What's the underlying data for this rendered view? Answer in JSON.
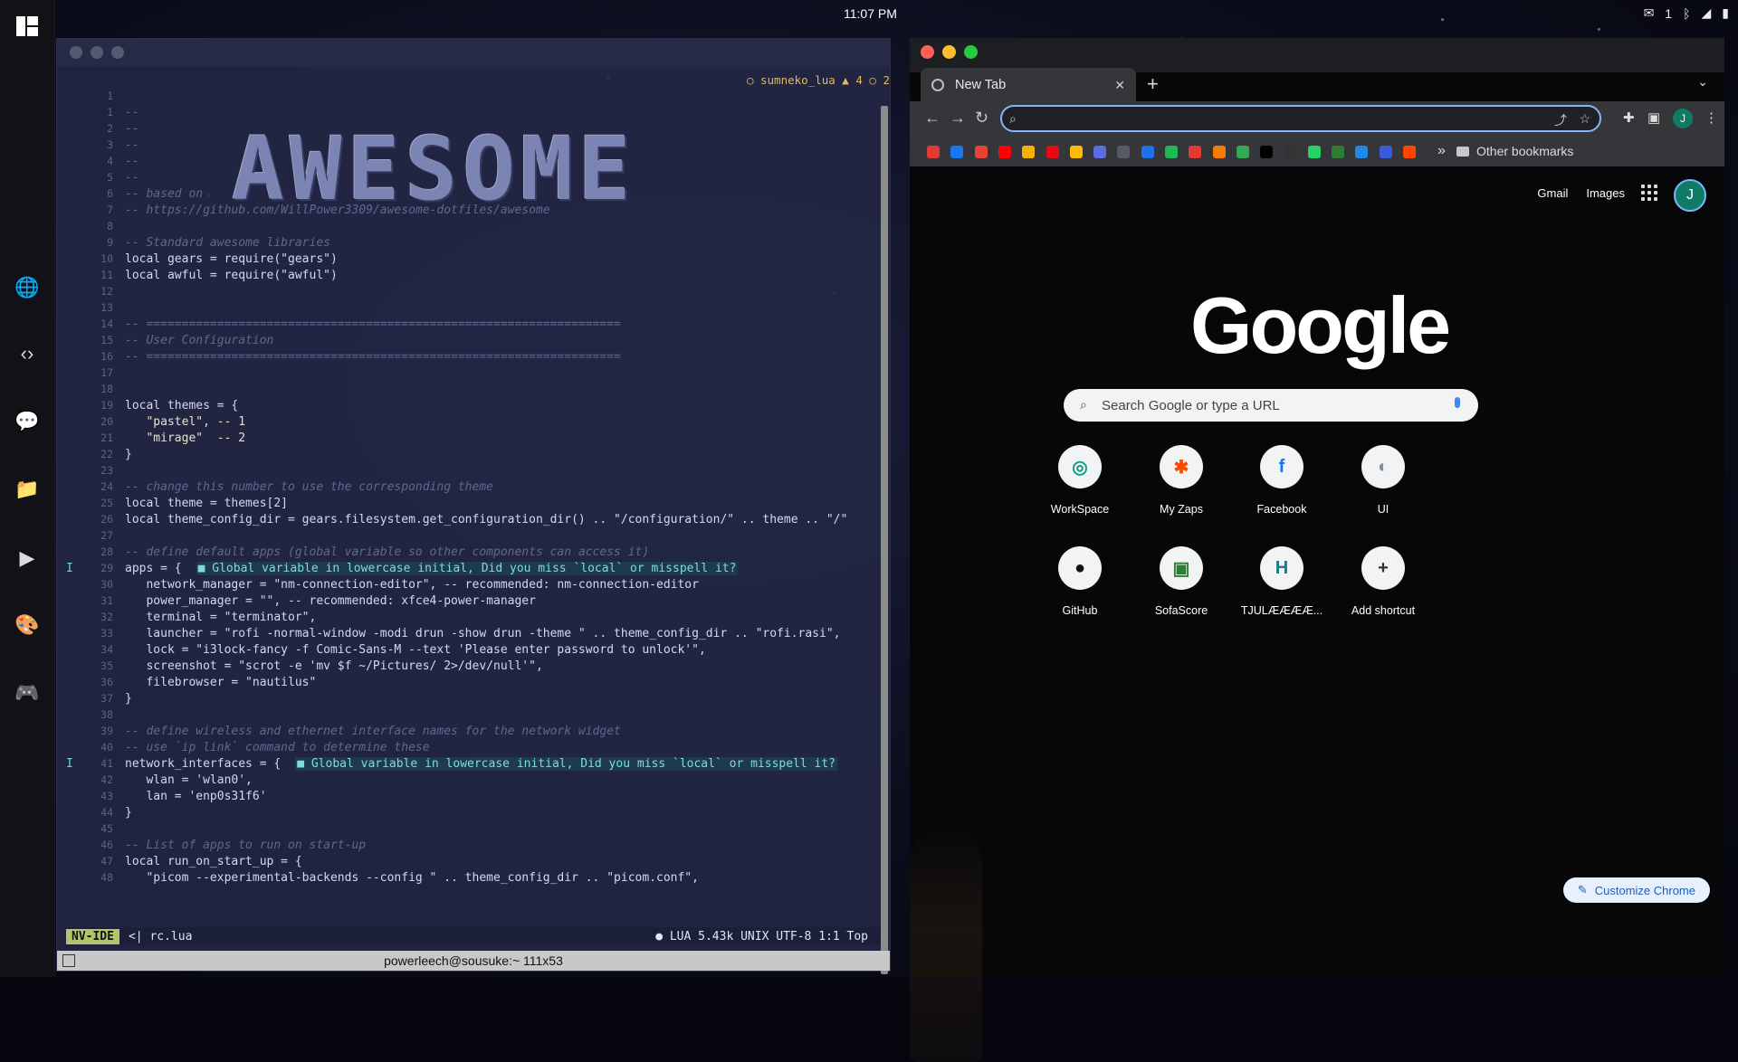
{
  "system": {
    "clock": "11:07 PM",
    "tray": {
      "mail_count": "1"
    }
  },
  "dock": {
    "items": [
      {
        "name": "globe-icon",
        "glyph": "🌐"
      },
      {
        "name": "code-icon",
        "glyph": "‹›"
      },
      {
        "name": "chat-icon",
        "glyph": "💬"
      },
      {
        "name": "folder-icon",
        "glyph": "📁"
      },
      {
        "name": "play-icon",
        "glyph": "▶"
      },
      {
        "name": "palette-icon",
        "glyph": "🎨"
      },
      {
        "name": "gamepad-icon",
        "glyph": "🎮"
      }
    ]
  },
  "terminal": {
    "lsp_status": "○ sumneko_lua  ▲ 4 ○ 2",
    "banner": "AWESOME",
    "lines": [
      {
        "n": "1",
        "t": "",
        "cls": "c-plain"
      },
      {
        "n": "1",
        "t": "--",
        "cls": "c-com"
      },
      {
        "n": "2",
        "t": "--",
        "cls": "c-com"
      },
      {
        "n": "3",
        "t": "--",
        "cls": "c-com"
      },
      {
        "n": "4",
        "t": "--",
        "cls": "c-com"
      },
      {
        "n": "5",
        "t": "--",
        "cls": "c-com"
      },
      {
        "n": "6",
        "t": "-- based on",
        "cls": "c-com"
      },
      {
        "n": "7",
        "t": "-- https://github.com/WillPower3309/awesome-dotfiles/awesome",
        "cls": "c-com"
      },
      {
        "n": "8",
        "t": "",
        "cls": "c-plain"
      },
      {
        "n": "9",
        "t": "-- Standard awesome libraries",
        "cls": "c-com"
      },
      {
        "n": "10",
        "t": "local gears = require(\"gears\")",
        "cls": "c-plain"
      },
      {
        "n": "11",
        "t": "local awful = require(\"awful\")",
        "cls": "c-plain"
      },
      {
        "n": "12",
        "t": "",
        "cls": "c-plain"
      },
      {
        "n": "13",
        "t": "",
        "cls": "c-plain"
      },
      {
        "n": "14",
        "t": "-- ===================================================================",
        "cls": "c-com"
      },
      {
        "n": "15",
        "t": "-- User Configuration",
        "cls": "c-com"
      },
      {
        "n": "16",
        "t": "-- ===================================================================",
        "cls": "c-com"
      },
      {
        "n": "17",
        "t": "",
        "cls": "c-plain"
      },
      {
        "n": "18",
        "t": "",
        "cls": "c-plain"
      },
      {
        "n": "19",
        "t": "local themes = {",
        "cls": "c-plain"
      },
      {
        "n": "20",
        "t": "   \"pastel\", -- 1",
        "cls": "c-str"
      },
      {
        "n": "21",
        "t": "   \"mirage\"  -- 2",
        "cls": "c-str"
      },
      {
        "n": "22",
        "t": "}",
        "cls": "c-plain"
      },
      {
        "n": "23",
        "t": "",
        "cls": "c-plain"
      },
      {
        "n": "24",
        "t": "-- change this number to use the corresponding theme",
        "cls": "c-com"
      },
      {
        "n": "25",
        "t": "local theme = themes[2]",
        "cls": "c-plain"
      },
      {
        "n": "26",
        "t": "local theme_config_dir = gears.filesystem.get_configuration_dir() .. \"/configuration/\" .. theme .. \"/\"",
        "cls": "c-plain"
      },
      {
        "n": "27",
        "t": "",
        "cls": "c-plain"
      },
      {
        "n": "28",
        "t": "-- define default apps (global variable so other components can access it)",
        "cls": "c-com"
      },
      {
        "n": "29",
        "t": "apps = {",
        "cls": "c-plain",
        "sign": "I",
        "diag": "■ Global variable in lowercase initial, Did you miss `local` or misspell it?"
      },
      {
        "n": "30",
        "t": "   network_manager = \"nm-connection-editor\", -- recommended: nm-connection-editor",
        "cls": "c-plain"
      },
      {
        "n": "31",
        "t": "   power_manager = \"\", -- recommended: xfce4-power-manager",
        "cls": "c-plain"
      },
      {
        "n": "32",
        "t": "   terminal = \"terminator\",",
        "cls": "c-plain"
      },
      {
        "n": "33",
        "t": "   launcher = \"rofi -normal-window -modi drun -show drun -theme \" .. theme_config_dir .. \"rofi.rasi\",",
        "cls": "c-plain"
      },
      {
        "n": "34",
        "t": "   lock = \"i3lock-fancy -f Comic-Sans-M --text 'Please enter password to unlock'\",",
        "cls": "c-plain"
      },
      {
        "n": "35",
        "t": "   screenshot = \"scrot -e 'mv $f ~/Pictures/ 2>/dev/null'\",",
        "cls": "c-plain"
      },
      {
        "n": "36",
        "t": "   filebrowser = \"nautilus\"",
        "cls": "c-plain"
      },
      {
        "n": "37",
        "t": "}",
        "cls": "c-plain"
      },
      {
        "n": "38",
        "t": "",
        "cls": "c-plain"
      },
      {
        "n": "39",
        "t": "-- define wireless and ethernet interface names for the network widget",
        "cls": "c-com"
      },
      {
        "n": "40",
        "t": "-- use `ip link` command to determine these",
        "cls": "c-com"
      },
      {
        "n": "41",
        "t": "network_interfaces = {",
        "cls": "c-plain",
        "sign": "I",
        "diag": "■ Global variable in lowercase initial, Did you miss `local` or misspell it?"
      },
      {
        "n": "42",
        "t": "   wlan = 'wlan0',",
        "cls": "c-plain"
      },
      {
        "n": "43",
        "t": "   lan = 'enp0s31f6'",
        "cls": "c-plain"
      },
      {
        "n": "44",
        "t": "}",
        "cls": "c-plain"
      },
      {
        "n": "45",
        "t": "",
        "cls": "c-plain"
      },
      {
        "n": "46",
        "t": "-- List of apps to run on start-up",
        "cls": "c-com"
      },
      {
        "n": "47",
        "t": "local run_on_start_up = {",
        "cls": "c-plain"
      },
      {
        "n": "48",
        "t": "   \"picom --experimental-backends --config \" .. theme_config_dir .. \"picom.conf\",",
        "cls": "c-plain"
      }
    ],
    "status": {
      "mode": "NV-IDE",
      "file": "<| rc.lua",
      "right": "● LUA 5.43k UNIX UTF-8 1:1 Top"
    },
    "footer": "powerleech@sousuke:~ 111x53"
  },
  "chrome": {
    "tab_title": "New Tab",
    "omnibox_placeholder": "",
    "bookmarks_more": "»",
    "other_bookmarks": "Other bookmarks",
    "bookmark_colors": [
      "#e53935",
      "#1877f2",
      "#ea4335",
      "#ff0000",
      "#f4b400",
      "#e50914",
      "#fbbc05",
      "#5b6ee1",
      "#555a66",
      "#1f6feb",
      "#1db954",
      "#e53935",
      "#f57c00",
      "#34a853",
      "#000000",
      "#333333",
      "#25d366",
      "#2e7d32",
      "#1e88e5",
      "#3b5bdb",
      "#ff4500"
    ],
    "profile_initial": "J",
    "ntp": {
      "gmail": "Gmail",
      "images": "Images",
      "logo": "Google",
      "search_placeholder": "Search Google or type a URL",
      "shortcuts": [
        {
          "label": "WorkSpace",
          "glyph": "◎",
          "color": "#0f9d8a"
        },
        {
          "label": "My Zaps",
          "glyph": "✱",
          "color": "#ff4a00"
        },
        {
          "label": "Facebook",
          "glyph": "f",
          "color": "#1877f2"
        },
        {
          "label": "UI",
          "glyph": "◐",
          "color": "#7a8fa6"
        },
        {
          "label": "GitHub",
          "glyph": "●",
          "color": "#111111"
        },
        {
          "label": "SofaScore",
          "glyph": "▣",
          "color": "#2e7d32"
        },
        {
          "label": "TJULÆÆÆÆ...",
          "glyph": "H",
          "color": "#127f8c"
        },
        {
          "label": "Add shortcut",
          "glyph": "+",
          "color": "#333333"
        }
      ],
      "customize": "Customize Chrome"
    }
  }
}
